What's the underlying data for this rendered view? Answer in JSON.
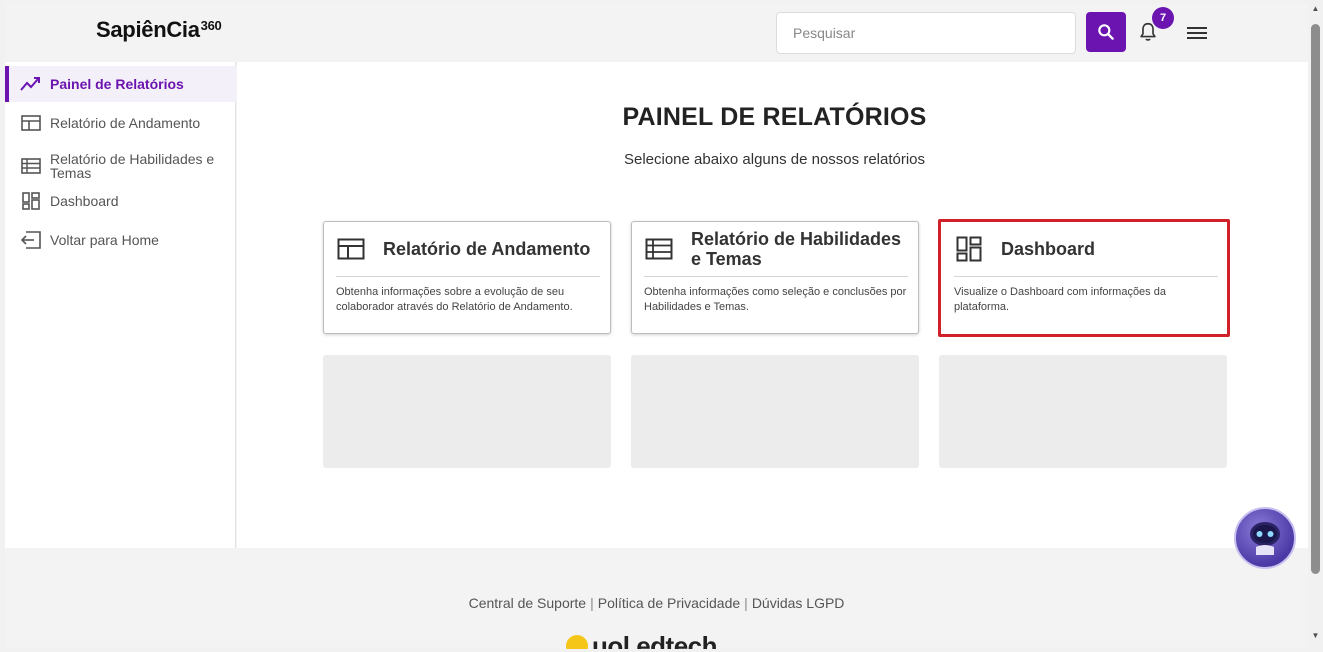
{
  "header": {
    "logo_text": "SapiênCia",
    "logo_suffix": "360",
    "search_placeholder": "Pesquisar",
    "notification_count": "7"
  },
  "sidebar": {
    "items": [
      {
        "label": "Painel de Relatórios",
        "icon": "trend-chart-icon",
        "active": true
      },
      {
        "label": "Relatório de Andamento",
        "icon": "table-layout-icon"
      },
      {
        "label": "Relatório de Habilidades e Temas",
        "icon": "list-table-icon"
      },
      {
        "label": "Dashboard",
        "icon": "dashboard-icon"
      },
      {
        "label": "Voltar para Home",
        "icon": "exit-arrow-icon"
      }
    ]
  },
  "main": {
    "title": "PAINEL DE RELATÓRIOS",
    "subtitle": "Selecione abaixo alguns de nossos relatórios",
    "cards": [
      {
        "title": "Relatório de Andamento",
        "description": "Obtenha informações sobre a evolução de seu colaborador através do Relatório de Andamento.",
        "icon": "table-layout-icon"
      },
      {
        "title": "Relatório de Habilidades e Temas",
        "description": "Obtenha informações como seleção e conclusões por Habilidades e Temas.",
        "icon": "list-table-icon"
      },
      {
        "title": "Dashboard",
        "description": "Visualize o Dashboard com informações da plataforma.",
        "icon": "dashboard-icon",
        "highlighted": true
      }
    ]
  },
  "footer": {
    "links": [
      "Central de Suporte",
      "Política de Privacidade",
      "Dúvidas LGPD"
    ],
    "logo_text": "uol edtech"
  },
  "colors": {
    "accent": "#6b14b0",
    "highlight": "#d0202a"
  }
}
